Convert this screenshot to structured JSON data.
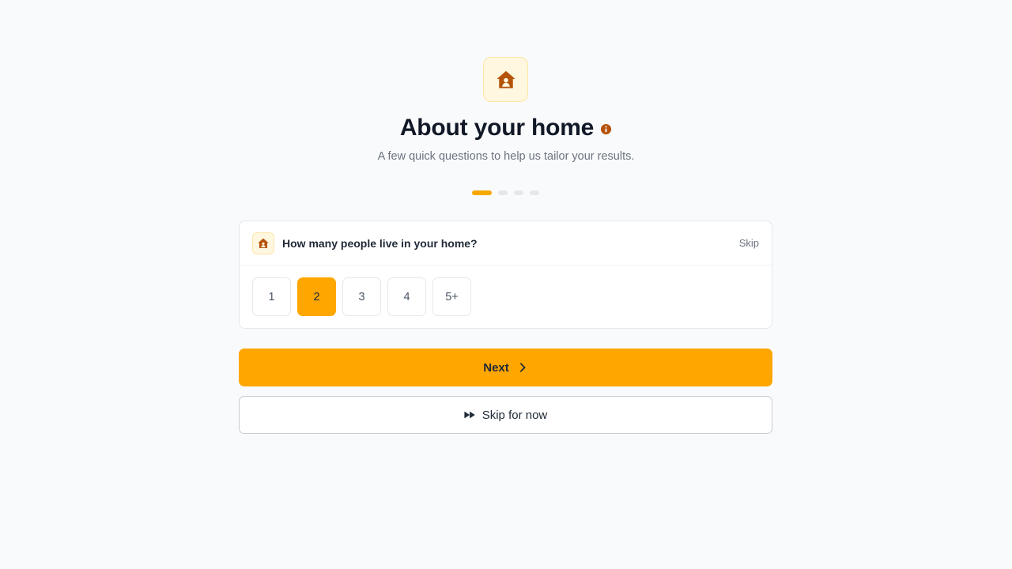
{
  "header": {
    "icon": "home-icon",
    "title": "About your home",
    "info_icon": "info-icon",
    "subtitle": "A few quick questions to help us tailor your results."
  },
  "progress": {
    "current_step": 1,
    "total_steps": 4
  },
  "question": {
    "icon": "home-icon",
    "text": "How many people live in your home?",
    "skip_label": "Skip",
    "options": [
      "1",
      "2",
      "3",
      "4",
      "5+"
    ],
    "selected": "2"
  },
  "actions": {
    "next_label": "Next",
    "next_icon": "chevron-right-icon",
    "skip_label": "Skip for now",
    "skip_icon": "fast-forward-icon"
  },
  "colors": {
    "accent": "#ffa600",
    "accent_dark": "#b45309",
    "background": "#f9fafb"
  }
}
